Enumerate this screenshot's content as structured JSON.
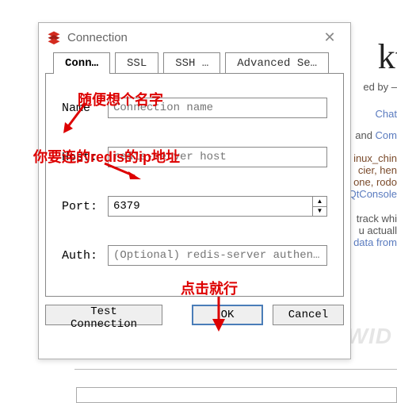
{
  "dialog": {
    "title": "Connection",
    "close_glyph": "✕",
    "tabs": [
      "Conn…",
      "SSL",
      "SSH …",
      "Advanced Se…"
    ],
    "fields": {
      "name_label": "Name",
      "name_placeholder": "Connection name",
      "host_label": "Host:",
      "host_placeholder": "redis-server host",
      "port_label": "Port:",
      "port_value": "6379",
      "auth_label": "Auth:",
      "auth_placeholder": "(Optional) redis-server authen…"
    },
    "buttons": {
      "test": "Test Connection",
      "ok": "OK",
      "cancel": "Cancel"
    }
  },
  "annotations": {
    "name_hint": "随便想个名字",
    "host_hint": "你要连的redis的ip地址",
    "ok_hint": "点击就行"
  },
  "background": {
    "big_text": "kt",
    "line1": "ed by –",
    "chat": "Chat",
    "line2_and": " and ",
    "line2_com": "Com",
    "line3": "inux_chin",
    "line4": "cier, hen",
    "line5": "one, rodo",
    "qtconsole": "QtConsole",
    "line6": "track whi",
    "line7": "u actuall",
    "line8": "data from"
  },
  "watermark": "HWID"
}
